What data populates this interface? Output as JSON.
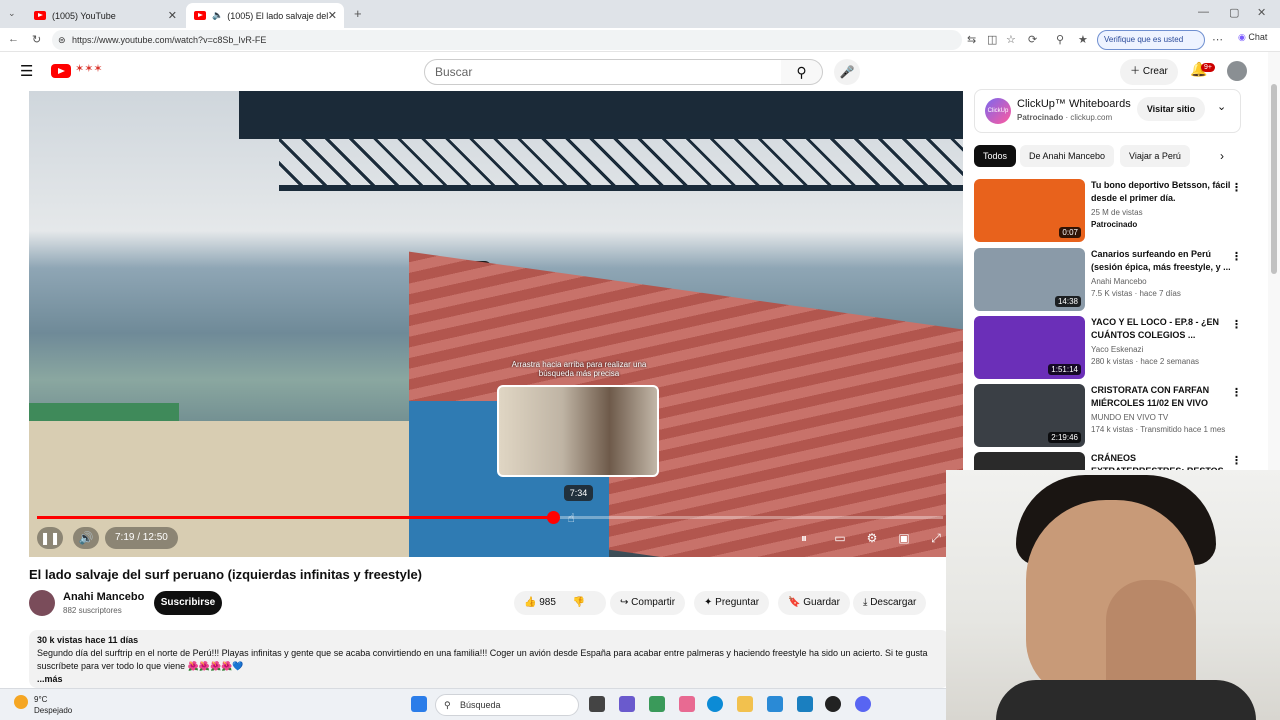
{
  "browser": {
    "tabs": [
      {
        "title": "(1005) YouTube"
      },
      {
        "title": "(1005) El lado salvaje del surf"
      }
    ],
    "url": "https://www.youtube.com/watch?v=c8Sb_IvR-FE",
    "verify_label": "Verifique que es usted",
    "chat_label": "Chat"
  },
  "header": {
    "search_placeholder": "Buscar",
    "create_label": "Crear",
    "notif_count": "9+"
  },
  "player": {
    "drag_hint": "Arrastra hacia arriba para realizar una búsqueda más precisa",
    "preview_time": "7:34",
    "time_display": "7:19 / 12:50",
    "progress_fraction": 0.57,
    "hover_fraction": 0.59
  },
  "video": {
    "title": "El lado salvaje del surf peruano (izquierdas infinitas y freestyle)",
    "channel": "Anahi Mancebo",
    "subscribers": "882 suscriptores",
    "subscribe_label": "Suscribirse",
    "likes": "985",
    "share_label": "Compartir",
    "ask_label": "Preguntar",
    "save_label": "Guardar",
    "download_label": "Descargar",
    "stats": "30 k vistas  hace 11 días",
    "description": "Segundo día del surftrip en el norte de Perú!!! Playas infinitas y gente que se acaba convirtiendo en una familia!!! Coger un avión desde España para acabar entre palmeras y haciendo freestyle ha sido un acierto. Si te gusta",
    "description2": "suscríbete para ver todo lo que viene 🌺🌺🌺🌺💙",
    "more_label": "...más"
  },
  "sidebar": {
    "ad": {
      "title": "ClickUp™ Whiteboards",
      "sponsored": "Patrocinado",
      "domain": "· clickup.com",
      "button": "Visitar sitio",
      "logo_text": "ClickUp"
    },
    "chips": [
      "Todos",
      "De Anahi Mancebo",
      "Viajar a Perú"
    ],
    "videos": [
      {
        "title": "Tu bono deportivo Betsson, fácil desde el primer día.",
        "meta1": "25 M de vistas",
        "meta2": "Patrocinado",
        "duration": "0:07",
        "color": "#e8621c"
      },
      {
        "title": "Canarios surfeando en Perú (sesión épica, más freestyle, y ...",
        "meta1": "Anahi Mancebo",
        "meta2": "7.5 K vistas · hace 7 días",
        "duration": "14:38",
        "color": "#8a9aa8"
      },
      {
        "title": "YACO Y EL LOCO - EP.8 - ¿EN CUÁNTOS COLEGIOS ...",
        "meta1": "Yaco Eskenazi",
        "meta2": "280 k vistas · hace 2 semanas",
        "duration": "1:51:14",
        "color": "#6b2fb8"
      },
      {
        "title": "CRISTORATA CON FARFAN MIÉRCOLES 11/02 EN VIVO",
        "meta1": "MUNDO EN VIVO TV",
        "meta2": "174 k vistas · Transmitido hace 1 mes",
        "duration": "2:19:46",
        "color": "#3a3f45"
      },
      {
        "title": "CRÁNEOS EXTRATERRESTRES: RESTOS QUE DESAFÍAN LA ...",
        "meta1": "",
        "meta2": "",
        "duration": "",
        "color": "#2a2a2a"
      }
    ]
  },
  "taskbar": {
    "temp": "9°C",
    "weather": "Despejado",
    "search_label": "Búsqueda"
  }
}
